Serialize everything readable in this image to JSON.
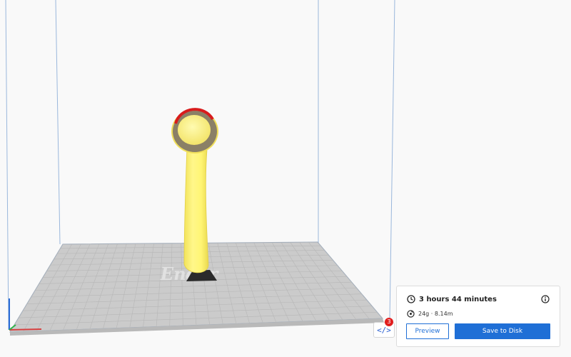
{
  "print_panel": {
    "print_time": "3 hours 44 minutes",
    "material": "24g · 8.14m",
    "preview_label": "Preview",
    "save_label": "Save to Disk"
  },
  "marker_badge": "3",
  "marker_icon_text": "</>",
  "colors": {
    "accent": "#1f6fd6",
    "model": "#fff574",
    "build_plate": "#c9c9c9",
    "badge": "#e01e1e"
  }
}
